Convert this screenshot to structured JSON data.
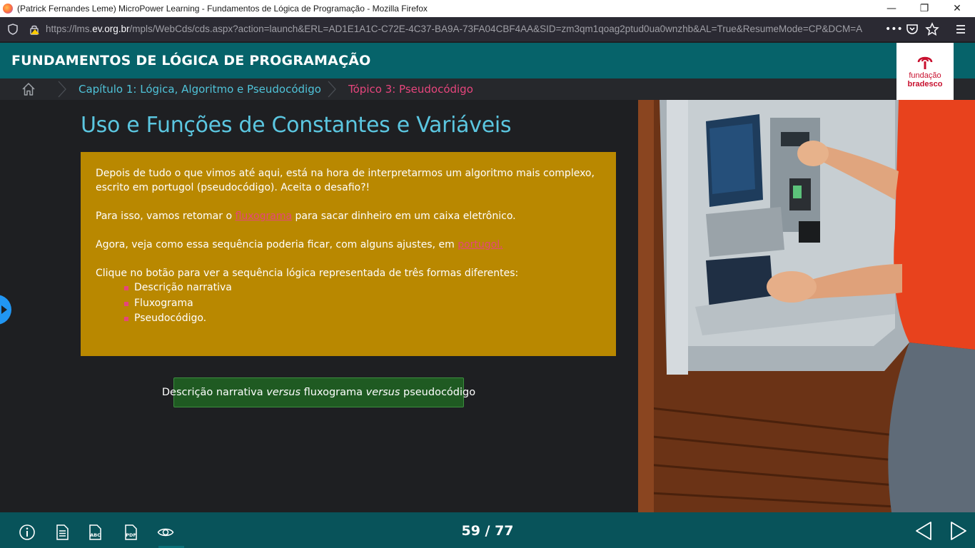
{
  "browser": {
    "window_title": "(Patrick Fernandes Leme) MicroPower Learning - Fundamentos de Lógica de Programação - Mozilla Firefox",
    "url_prefix": "https://lms.",
    "url_domain": "ev.org.br",
    "url_rest": "/mpls/WebCds/cds.aspx?action=launch&ERL=AD1E1A1C-C72E-4C37-BA9A-73FA04CBF4AA&SID=zm3qm1qoag2ptud0ua0wnzhb&AL=True&ResumeMode=CP&DCM=A",
    "minimize": "—",
    "restore": "❐",
    "close": "✕"
  },
  "header": {
    "course_title": "FUNDAMENTOS DE LÓGICA DE PROGRAMAÇÃO",
    "logo_line1": "fundação",
    "logo_line2": "bradesco",
    "brand_color": "#c8102e"
  },
  "breadcrumb": {
    "chapter": "Capítulo 1: Lógica, Algoritmo e Pseudocódigo",
    "topic": "Tópico 3: Pseudocódigo"
  },
  "main": {
    "heading": "Uso e Funções de Constantes e Variáveis",
    "para1": "Depois de tudo o que vimos até aqui, está na hora de interpretarmos um algoritmo mais complexo, escrito em portugol (pseudocódigo). Aceita o desafio?!",
    "para2_before": "Para isso, vamos retomar o ",
    "para2_link": "fluxograma",
    "para2_after": " para sacar dinheiro em um caixa eletrônico.",
    "para3_before": "Agora, veja como essa sequência poderia ficar, com alguns ajustes, em ",
    "para3_link": "portugol.",
    "para4": "Clique no botão para ver a sequência lógica representada de três formas diferentes:",
    "list": [
      "Descrição narrativa",
      "Fluxograma",
      "Pseudocódigo."
    ],
    "button_part1": "Descrição narrativa ",
    "button_italic1": "versus",
    "button_part2": " fluxograma ",
    "button_italic2": "versus",
    "button_part3": " pseudocódigo"
  },
  "footer": {
    "page_indicator": "59 / 77",
    "icons": [
      "info-icon",
      "document-icon",
      "glossary-icon",
      "pdf-icon",
      "eye-icon"
    ],
    "abc_label": "ABC",
    "pdf_label": "PDF"
  },
  "colors": {
    "teal_header": "#06636a",
    "footer": "#08535a",
    "content_box": "#b98800",
    "link_pink": "#e6457c",
    "heading_cyan": "#5bc6e0",
    "button_green": "#1f5a22"
  }
}
